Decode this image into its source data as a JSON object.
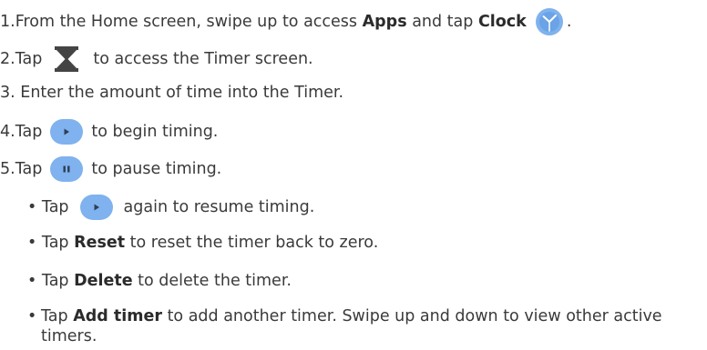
{
  "steps": [
    {
      "num": "1.",
      "pre": "From the Home screen, swipe up to access ",
      "apps": "Apps",
      "mid": " and tap ",
      "clock": "Clock",
      "post": "."
    },
    {
      "num": "2.",
      "pre": "Tap",
      "post": "to access the Timer screen."
    },
    {
      "num": "3.",
      "text": "Enter the amount of time into the Timer."
    },
    {
      "num": "4.",
      "pre": "Tap",
      "post": "to begin timing."
    },
    {
      "num": "5.",
      "pre": "Tap",
      "post": "to pause timing."
    }
  ],
  "bullets": [
    {
      "pre": "Tap",
      "post": "again to resume timing."
    },
    {
      "pre": "Tap ",
      "bold": "Reset",
      "post": " to reset the timer back to zero."
    },
    {
      "pre": "Tap ",
      "bold": "Delete",
      "post": " to delete the timer."
    },
    {
      "pre": "Tap ",
      "bold": "Add timer",
      "post": " to add another timer. Swipe up and down to view other active timers."
    }
  ],
  "bullet_glyph": "•",
  "colors": {
    "icon_blue": "#7fb2ee",
    "text": "#3a3a3a",
    "hourglass": "#444444"
  },
  "icons": {
    "clock": "clock-app-icon",
    "hourglass": "hourglass-icon",
    "play": "play-icon",
    "pause": "pause-icon"
  }
}
